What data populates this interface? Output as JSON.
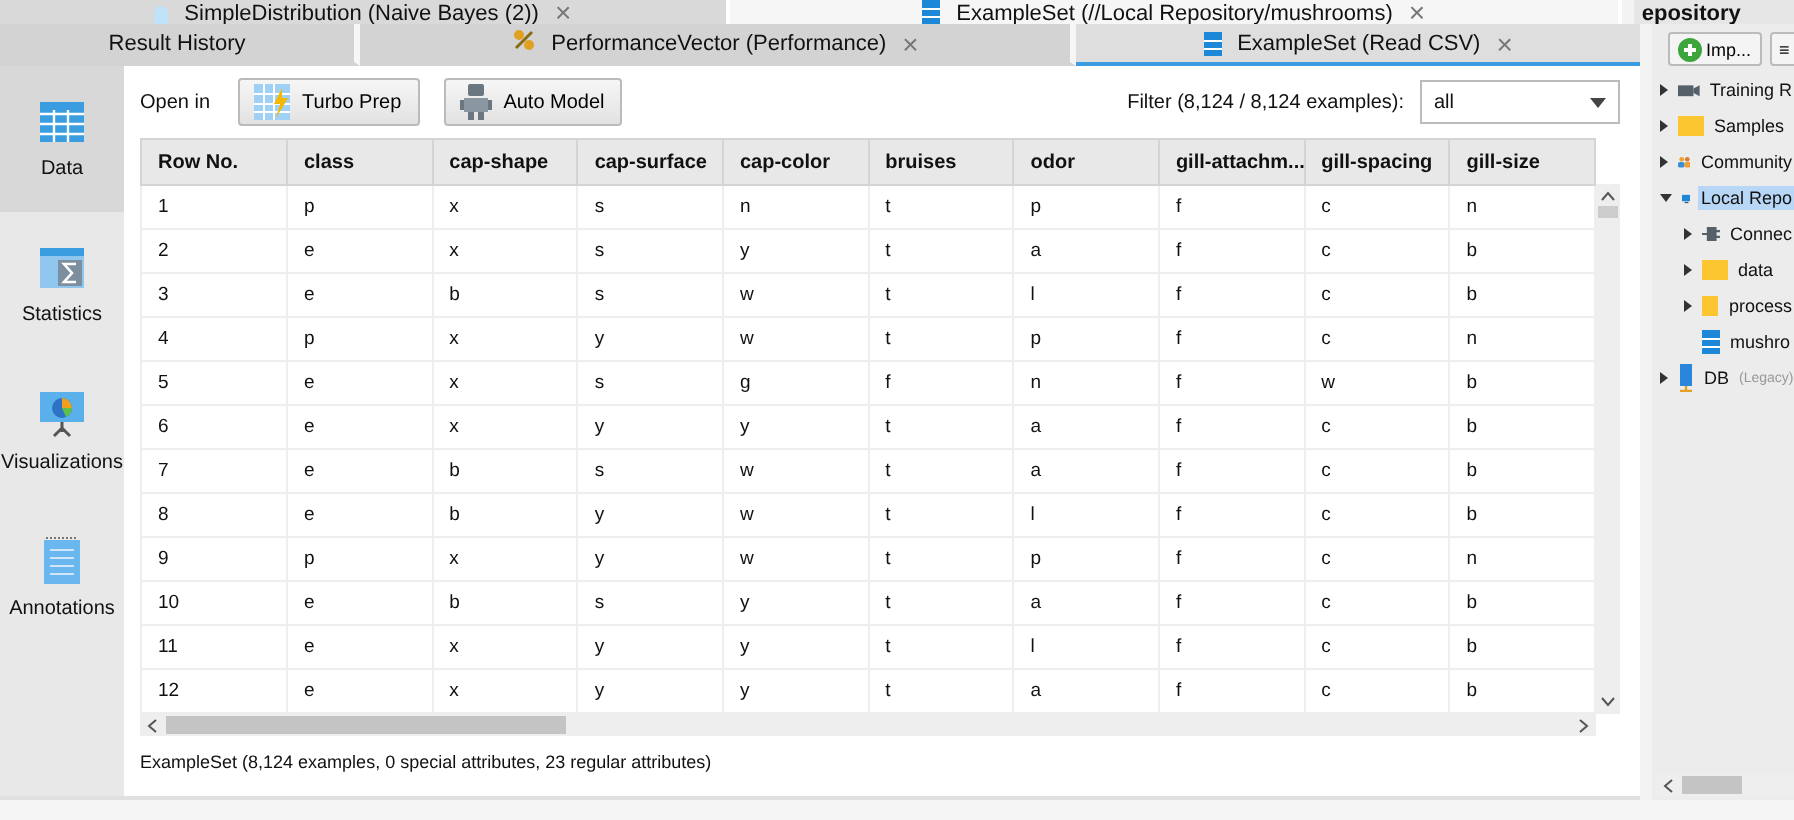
{
  "top_tabs": [
    {
      "label": "SimpleDistribution (Naive Bayes (2))",
      "selected": false,
      "close": "×"
    },
    {
      "label": "ExampleSet (//Local Repository/mushrooms)",
      "selected": true,
      "close": "×"
    }
  ],
  "result_tabs": [
    {
      "label": "Result History",
      "selected": false
    },
    {
      "label": "PerformanceVector (Performance)",
      "selected": false,
      "close": "×"
    },
    {
      "label": "ExampleSet (Read CSV)",
      "selected": true,
      "close": "×"
    }
  ],
  "sidebar": {
    "items": [
      {
        "label": "Data",
        "selected": true
      },
      {
        "label": "Statistics",
        "selected": false
      },
      {
        "label": "Visualizations",
        "selected": false
      },
      {
        "label": "Annotations",
        "selected": false
      }
    ]
  },
  "toolbar": {
    "open_in": "Open in",
    "buttons": [
      {
        "label": "Turbo Prep"
      },
      {
        "label": "Auto Model"
      }
    ],
    "filter_label": "Filter (8,124 / 8,124 examples):",
    "filter_value": "all"
  },
  "table": {
    "columns": [
      "Row No.",
      "class",
      "cap-shape",
      "cap-surface",
      "cap-color",
      "bruises",
      "odor",
      "gill-attachm...",
      "gill-spacing",
      "gill-size"
    ],
    "rows": [
      [
        "1",
        "p",
        "x",
        "s",
        "n",
        "t",
        "p",
        "f",
        "c",
        "n"
      ],
      [
        "2",
        "e",
        "x",
        "s",
        "y",
        "t",
        "a",
        "f",
        "c",
        "b"
      ],
      [
        "3",
        "e",
        "b",
        "s",
        "w",
        "t",
        "l",
        "f",
        "c",
        "b"
      ],
      [
        "4",
        "p",
        "x",
        "y",
        "w",
        "t",
        "p",
        "f",
        "c",
        "n"
      ],
      [
        "5",
        "e",
        "x",
        "s",
        "g",
        "f",
        "n",
        "f",
        "w",
        "b"
      ],
      [
        "6",
        "e",
        "x",
        "y",
        "y",
        "t",
        "a",
        "f",
        "c",
        "b"
      ],
      [
        "7",
        "e",
        "b",
        "s",
        "w",
        "t",
        "a",
        "f",
        "c",
        "b"
      ],
      [
        "8",
        "e",
        "b",
        "y",
        "w",
        "t",
        "l",
        "f",
        "c",
        "b"
      ],
      [
        "9",
        "p",
        "x",
        "y",
        "w",
        "t",
        "p",
        "f",
        "c",
        "n"
      ],
      [
        "10",
        "e",
        "b",
        "s",
        "y",
        "t",
        "a",
        "f",
        "c",
        "b"
      ],
      [
        "11",
        "e",
        "x",
        "y",
        "y",
        "t",
        "l",
        "f",
        "c",
        "b"
      ],
      [
        "12",
        "e",
        "x",
        "y",
        "y",
        "t",
        "a",
        "f",
        "c",
        "b"
      ]
    ]
  },
  "status_bar": "ExampleSet (8,124 examples, 0 special attributes, 23 regular attributes)",
  "repository": {
    "title": "epository",
    "import_button": "Imp...",
    "menu_button": "≡",
    "tree": [
      {
        "label": "Training R",
        "expanded": false,
        "selected": false
      },
      {
        "label": "Samples",
        "expanded": false,
        "selected": false
      },
      {
        "label": "Community",
        "expanded": false,
        "selected": false
      },
      {
        "label": "Local Repo",
        "expanded": true,
        "selected": true,
        "children": [
          {
            "label": "Connec",
            "expanded": false,
            "selected": false
          },
          {
            "label": "data",
            "expanded": false,
            "selected": false
          },
          {
            "label": "process",
            "expanded": false,
            "selected": false
          },
          {
            "label": "mushro",
            "selected": false
          }
        ]
      },
      {
        "label": "DB",
        "hint": "(Legacy)",
        "expanded": false,
        "selected": false
      }
    ]
  }
}
